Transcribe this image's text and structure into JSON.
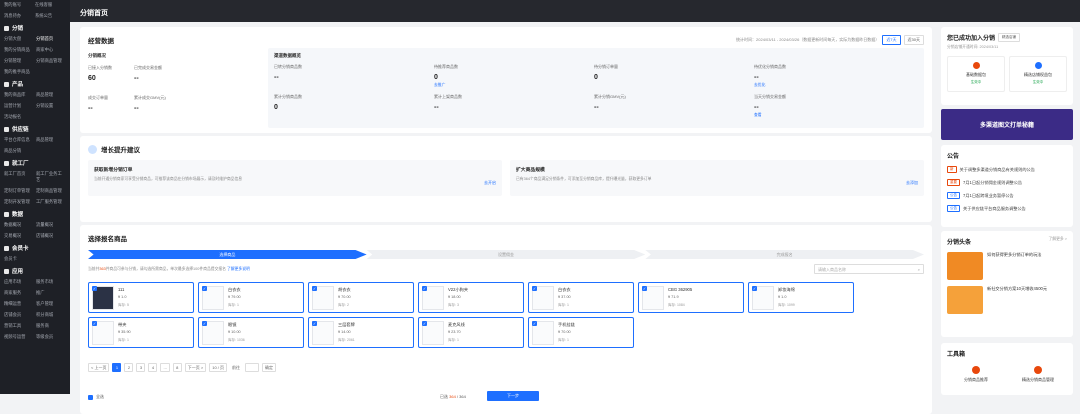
{
  "sidebar": {
    "top_items": [
      "我的账号",
      "在线客服",
      "消息待办",
      "系统公告"
    ],
    "groups": [
      {
        "title": "分销",
        "items": [
          "分销大盘",
          "分销首页",
          "我的分销商品",
          "商家中心",
          "分销管理",
          "分销商品管理",
          "我的推手商品"
        ],
        "active": 1
      },
      {
        "title": "产品",
        "items": [
          "我的商品库",
          "商品管理",
          "运营计划",
          "分销设置",
          "活动报名"
        ],
        "active": -1
      },
      {
        "title": "供应链",
        "items": [
          "平台仓库信息",
          "商品管理",
          "商品分销"
        ],
        "active": -1
      },
      {
        "title": "就工厂",
        "items": [
          "就工厂首页",
          "就工厂业务工艺",
          "定制订单管理",
          "定制商品管理",
          "定制开发管理",
          "工厂服务管理"
        ],
        "active": -1
      },
      {
        "title": "数据",
        "items": [
          "数据概况",
          "流量概况",
          "交易概况",
          "店铺概况"
        ],
        "active": -1
      },
      {
        "title": "会员卡",
        "items": [
          "会员卡"
        ],
        "active": -1
      },
      {
        "title": "应用",
        "items": [
          "应用市场",
          "服务市场",
          "商家服务",
          "推广",
          "精细运营",
          "客户管理",
          "店铺会员",
          "积分商城",
          "营销工具",
          "服务商",
          "视频号运营",
          "等级会员"
        ],
        "active": -1
      }
    ]
  },
  "page_title": "分销首页",
  "overview": {
    "title": "经营数据",
    "filter_text": "统计时间：2024/03/11 - 2024/03/26（数据更新时间每天，实际为数据昨日数据）",
    "btn_day": "近7天",
    "btn_more": "近30天",
    "left_title": "分销概况",
    "left_metrics": [
      {
        "label": "已接入分销数",
        "value": "60"
      },
      {
        "label": "已完成交易金额",
        "value": "--"
      },
      {
        "label": "成交订单量",
        "value": "--"
      },
      {
        "label": "累计成交GMV(元)",
        "value": "--"
      }
    ],
    "right_title": "渠道数据概览",
    "right_metrics": [
      {
        "label": "已转分销商品数",
        "value": "--",
        "link": ""
      },
      {
        "label": "待推荐商品数",
        "value": "0",
        "link": "去推广"
      },
      {
        "label": "待分销订单量",
        "value": "0",
        "link": ""
      },
      {
        "label": "待优化分销商品数",
        "value": "--",
        "link": "去优化"
      },
      {
        "label": "累计分销商品数",
        "value": "0",
        "link": ""
      },
      {
        "label": "累计上架商品数",
        "value": "--",
        "link": ""
      },
      {
        "label": "累计分销GMV(元)",
        "value": "--",
        "link": ""
      },
      {
        "label": "当天分销交易金额",
        "value": "--",
        "link": "查看"
      }
    ]
  },
  "suggestion": {
    "title": "增长提升建议",
    "cards": [
      {
        "title": "获取新增分销订单",
        "desc": "当前开通分销商家可享受分销商品，可推荐该商品在分销市场展示，请及时维护商品信息",
        "action": "去开启"
      },
      {
        "title": "扩大商品规模",
        "desc": "已有364个商品满足分销条件，可添加至分销商品库，提升曝光量，获取更多订单",
        "action": "去添加"
      }
    ]
  },
  "select": {
    "title": "选择报名商品",
    "steps": [
      "选择商品",
      "设置佣金",
      "完成报名"
    ],
    "hint_pre": "当前共",
    "hint_num": "363",
    "hint_post": "件商品可参与分销，请勾选所需商品，单次最多选择100件商品提交报名",
    "hint_link": "了解更多说明",
    "search_placeholder": "请输入商品名称",
    "products": [
      {
        "name": "111",
        "price": "¥ 1.0",
        "sales": "库存: 5",
        "dark": true
      },
      {
        "name": "白衣衣",
        "price": "¥ 79.00",
        "sales": "库存: 1",
        "dark": false
      },
      {
        "name": "胡衣衣",
        "price": "¥ 70.00",
        "sales": "库存: 2",
        "dark": false
      },
      {
        "name": "V22小狗夹",
        "price": "¥ 18.00",
        "sales": "库存: 3",
        "dark": false
      },
      {
        "name": "白衣衣",
        "price": "¥ 37.00",
        "sales": "库存: 1",
        "dark": false
      },
      {
        "name": "CBG 362905",
        "price": "¥ 71.9",
        "sales": "库存: 1084",
        "dark": false
      },
      {
        "name": "卸妆海绵",
        "price": "¥ 1.0",
        "sales": "库存: 1099",
        "dark": false
      },
      {
        "name": "带夹",
        "price": "¥ 35.90",
        "sales": "库存: 1",
        "dark": false
      },
      {
        "name": "眼镜",
        "price": "¥ 10.00",
        "sales": "库存: 1036",
        "dark": false
      },
      {
        "name": "三层套牌",
        "price": "¥ 14.00",
        "sales": "库存: 2061",
        "dark": false
      },
      {
        "name": "麦克风线",
        "price": "¥ 23.70",
        "sales": "库存: 1",
        "dark": false
      },
      {
        "name": "手机挂链",
        "price": "¥ 70.00",
        "sales": "库存: 1",
        "dark": false
      }
    ],
    "pager": {
      "prev": "< 上一页",
      "pages": [
        "1",
        "2",
        "3",
        "4",
        "..."
      ],
      "last": "8",
      "next": "下一页 >",
      "size": "10 / 页",
      "goto": "前往",
      "confirm": "确定"
    },
    "select_all": "全选",
    "selected_pre": "已选 ",
    "selected_num": "364",
    "selected_post": " / 364",
    "next_btn": "下一步"
  },
  "right": {
    "status_title": "您已成功加入分销",
    "status_tag": "精选店铺",
    "status_sub": "分销店铺开通时间: 2024/03/11",
    "tiles": [
      {
        "label": "基础数据包",
        "status": "生效中"
      },
      {
        "label": "精选店铺权益包",
        "status": "生效中"
      }
    ],
    "banner": "多渠道图文打单秘籍",
    "notice_title": "公告",
    "notices": [
      {
        "tag": "新",
        "text": "关于调整多渠道分销商品有关规则的公告"
      },
      {
        "tag": "重要",
        "text": "7月1日起分销佣金规则调整公告"
      },
      {
        "tag": "公告",
        "text": "7月1日起跨境业务暂停公告"
      },
      {
        "tag": "公告",
        "text": "关于供应链平台商品服务调整公告"
      }
    ],
    "headline_title": "分销头条",
    "headline_more": "了解更多 >",
    "headlines": [
      {
        "text": "如何获得更多分销订单的玩法"
      },
      {
        "text": "新社交分销方案10天增收4500元"
      }
    ],
    "toolbox_title": "工具箱",
    "tools": [
      "分销商品推荐",
      "精选分销商品管理"
    ]
  },
  "colors": {
    "primary": "#1e6fff",
    "sidebar": "#1e2026",
    "accent": "#e8480c",
    "banner": "#3b2b86"
  }
}
